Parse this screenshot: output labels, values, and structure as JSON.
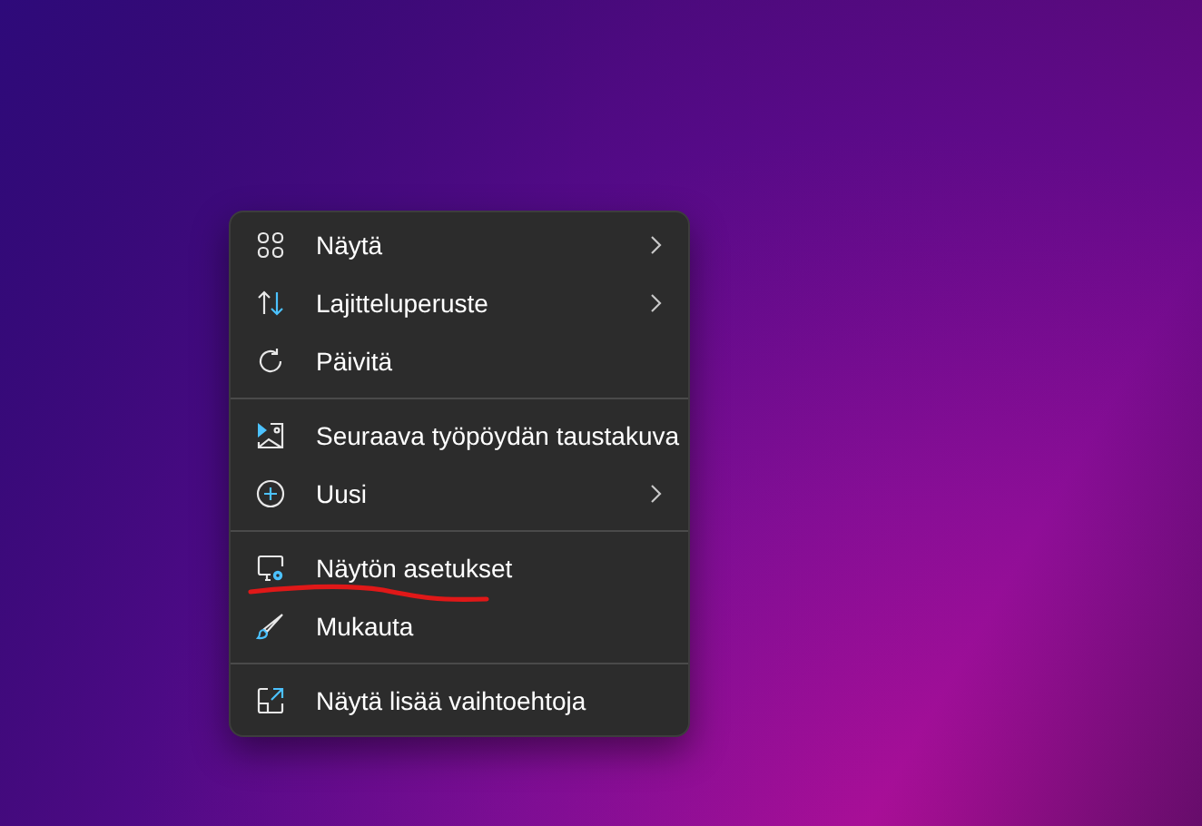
{
  "context_menu": {
    "entries": [
      {
        "kind": "item",
        "label": "Näytä",
        "submenu": true,
        "underlined": false
      },
      {
        "kind": "item",
        "label": "Lajitteluperuste",
        "submenu": true,
        "underlined": false
      },
      {
        "kind": "item",
        "label": "Päivitä",
        "submenu": false,
        "underlined": false
      },
      {
        "kind": "separator"
      },
      {
        "kind": "item",
        "label": "Seuraava työpöydän taustakuva",
        "submenu": false,
        "underlined": false
      },
      {
        "kind": "item",
        "label": "Uusi",
        "submenu": true,
        "underlined": false
      },
      {
        "kind": "separator"
      },
      {
        "kind": "item",
        "label": "Näytön asetukset",
        "submenu": false,
        "underlined": true
      },
      {
        "kind": "item",
        "label": "Mukauta",
        "submenu": false,
        "underlined": false
      },
      {
        "kind": "separator"
      },
      {
        "kind": "item",
        "label": "Näytä lisää vaihtoehtoja",
        "submenu": false,
        "underlined": false
      }
    ]
  }
}
